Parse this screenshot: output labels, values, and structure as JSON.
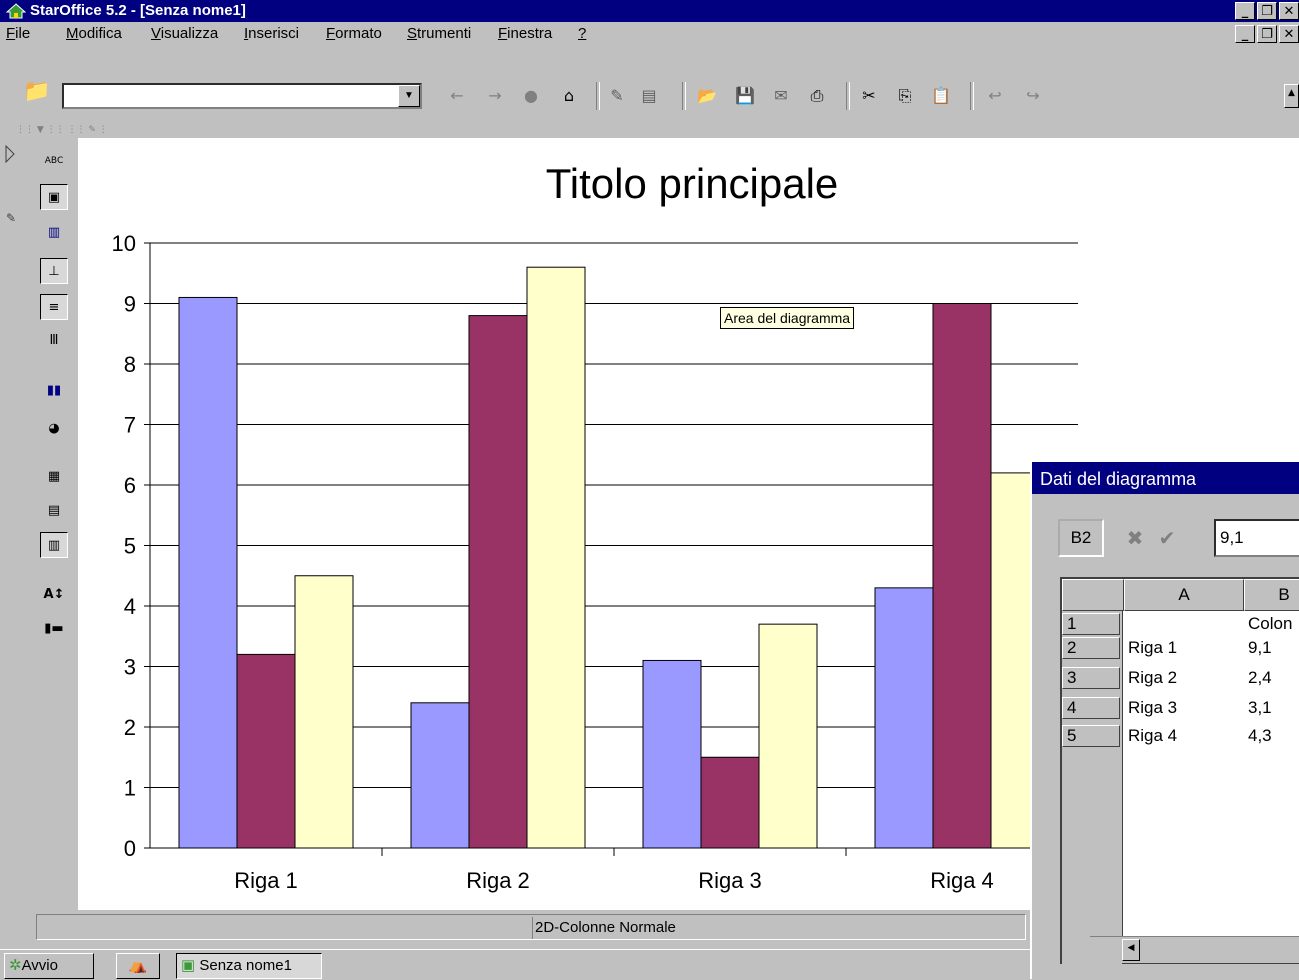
{
  "window": {
    "title": "StarOffice 5.2 - [Senza nome1]"
  },
  "menu": [
    "File",
    "Modifica",
    "Visualizza",
    "Inserisci",
    "Formato",
    "Strumenti",
    "Finestra",
    "?"
  ],
  "toolbar": {
    "url_value": ""
  },
  "chart_data": {
    "type": "bar",
    "title": "Titolo principale",
    "categories": [
      "Riga 1",
      "Riga 2",
      "Riga 3",
      "Riga 4"
    ],
    "series": [
      {
        "values": [
          9.1,
          2.4,
          3.1,
          4.3
        ],
        "color": "#9999ff"
      },
      {
        "values": [
          3.2,
          8.8,
          1.5,
          9.0
        ],
        "color": "#993366"
      },
      {
        "values": [
          4.5,
          9.6,
          3.7,
          6.2
        ],
        "color": "#ffffcc"
      }
    ],
    "ylim": [
      0,
      10
    ],
    "yticks": [
      "0",
      "1",
      "2",
      "3",
      "4",
      "5",
      "6",
      "7",
      "8",
      "9",
      "10"
    ],
    "grid": true
  },
  "tooltip": "Area del diagramma",
  "status": {
    "chart_type": "2D-Colonne Normale"
  },
  "taskbar": {
    "start": "Avvio",
    "task": "Senza nome1"
  },
  "dialog": {
    "title": "Dati del diagramma",
    "cell_ref": "B2",
    "cell_value": "9,1",
    "columns": [
      "A",
      "B"
    ],
    "row_numbers": [
      "1",
      "2",
      "3",
      "4",
      "5"
    ],
    "b1": "Colon",
    "rows": [
      {
        "a": "Riga 1",
        "b": "9,1"
      },
      {
        "a": "Riga 2",
        "b": "2,4"
      },
      {
        "a": "Riga 3",
        "b": "3,1"
      },
      {
        "a": "Riga 4",
        "b": "4,3"
      }
    ]
  }
}
